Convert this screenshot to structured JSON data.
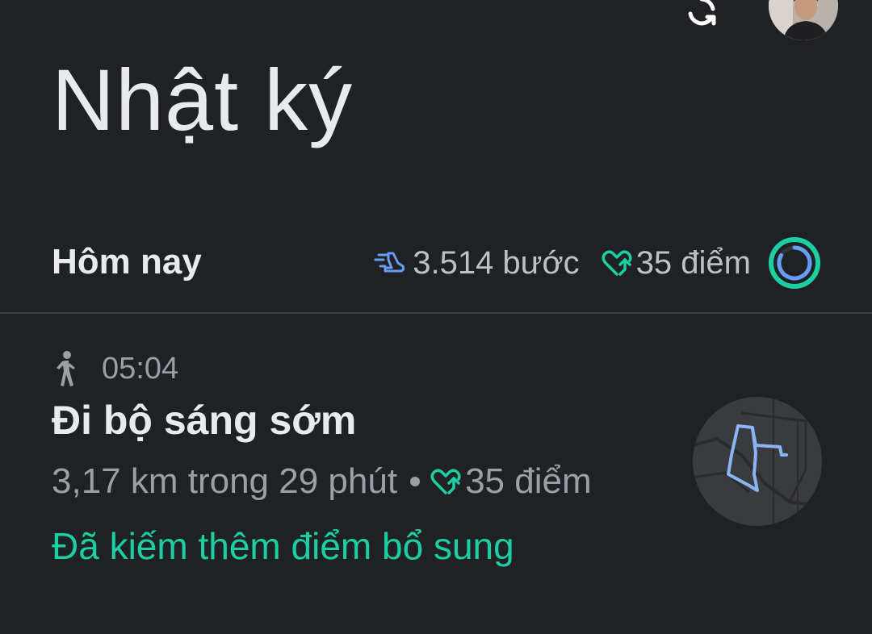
{
  "header": {
    "title": "Nhật ký",
    "sync_icon": "sync-icon",
    "avatar": "user-avatar"
  },
  "today": {
    "label": "Hôm nay",
    "steps": "3.514 bước",
    "heart_points": "35 điểm",
    "steps_icon": "steps-icon",
    "heart_icon": "heart-points-icon",
    "rings_icon": "activity-rings-icon"
  },
  "activity": {
    "type_icon": "walking-icon",
    "time": "05:04",
    "title": "Đi bộ sáng sớm",
    "summary": "3,17 km trong 29 phút",
    "heart_points": "35 điểm",
    "bonus": "Đã kiếm thêm điểm bổ sung",
    "map_icon": "route-map-thumbnail"
  },
  "colors": {
    "background": "#202124",
    "text_primary": "#e8eaed",
    "text_secondary": "#9aa0a6",
    "accent_teal": "#1ccfa3",
    "accent_blue": "#669df6",
    "divider": "#3c4043"
  }
}
